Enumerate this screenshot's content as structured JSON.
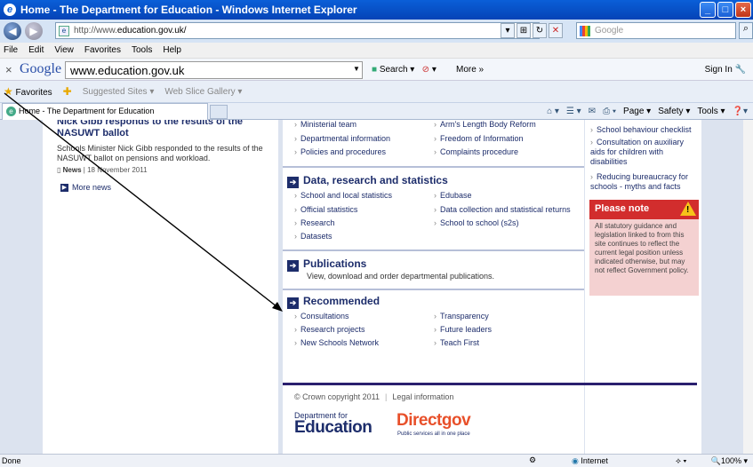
{
  "window": {
    "title": "Home - The Department for Education - Windows Internet Explorer"
  },
  "address_bar": {
    "url_prefix": "http://www.",
    "url_bold": "education.gov.uk/",
    "search_placeholder": "Google"
  },
  "menu": [
    "File",
    "Edit",
    "View",
    "Favorites",
    "Tools",
    "Help"
  ],
  "google_toolbar": {
    "close": "×",
    "logo": "Google",
    "input_value": "www.education.gov.uk",
    "search_label": "Search",
    "more_label": "More »",
    "sign_in": "Sign In"
  },
  "favorites_bar": {
    "favorites": "Favorites",
    "suggested": "Suggested Sites ▾",
    "webslice": "Web Slice Gallery ▾"
  },
  "tab": {
    "label": "Home - The Department for Education"
  },
  "command_bar": {
    "page": "Page ▾",
    "safety": "Safety ▾",
    "tools": "Tools ▾"
  },
  "news": {
    "headline_top": "Nick Gibb responds to the results of the",
    "headline": "NASUWT ballot",
    "summary": "Schools Minister Nick Gibb responded to the results of the NASUWT ballot on pensions and workload.",
    "type": "News",
    "date": "18 November 2011",
    "more": "More news"
  },
  "top_links_left": [
    "Ministerial team",
    "Departmental information",
    "Policies and procedures"
  ],
  "top_links_right": [
    "Arm's Length Body Reform",
    "Freedom of Information",
    "Complaints procedure"
  ],
  "data_section": {
    "heading": "Data, research and statistics",
    "left": [
      "School and local statistics",
      "Official statistics",
      "Research",
      "Datasets"
    ],
    "right": [
      "Edubase",
      "Data collection and statistical returns",
      "School to school (s2s)"
    ]
  },
  "publications": {
    "heading": "Publications",
    "text": "View, download and order departmental publications."
  },
  "recommended": {
    "heading": "Recommended",
    "left": [
      "Consultations",
      "Research projects",
      "New Schools Network"
    ],
    "right": [
      "Transparency",
      "Future leaders",
      "Teach First"
    ]
  },
  "right_links": [
    "School behaviour checklist",
    "Consultation on auxiliary aids for children with disabilities",
    "Reducing bureaucracy for schools - myths and facts"
  ],
  "please_note": {
    "heading": "Please note",
    "body": "All statutory guidance and legislation linked to from this site continues to reflect the current legal position unless indicated otherwise, but may not reflect Government policy."
  },
  "footer": {
    "copyright": "© Crown copyright 2011",
    "legal": "Legal information",
    "dfe_top": "Department for",
    "dfe_bottom": "Education",
    "directgov": "Directgov",
    "directgov_sub": "Public services all in one place"
  },
  "status": {
    "left": "Done",
    "zone": "Internet",
    "zoom": "100%"
  }
}
